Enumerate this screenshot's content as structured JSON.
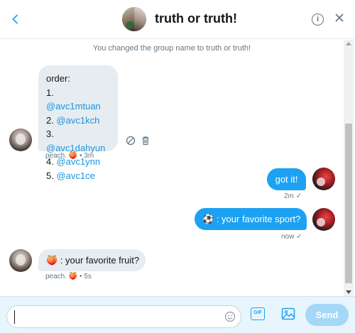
{
  "header": {
    "title": "truth or truth!",
    "back_icon": "chevron-left-icon",
    "info_icon": "info-icon",
    "close_icon": "close-icon"
  },
  "conversation": {
    "system_message": "You changed the group name to truth or truth!",
    "messages": [
      {
        "sender": "peach.",
        "direction": "incoming",
        "lines": [
          {
            "prefix": "order:",
            "mention": ""
          },
          {
            "prefix": "1. ",
            "mention": "@avc1mtuan"
          },
          {
            "prefix": "2. ",
            "mention": "@avc1kch"
          },
          {
            "prefix": "3. ",
            "mention": "@avc1dahyun"
          },
          {
            "prefix": "4. ",
            "mention": "@avc1ynn"
          },
          {
            "prefix": "5. ",
            "mention": "@avc1ce"
          }
        ],
        "meta": "peach. 🍑 • 3m"
      },
      {
        "direction": "outgoing",
        "text": "got it!",
        "meta": "2m",
        "status": "✓"
      },
      {
        "direction": "outgoing",
        "text": "⚽ : your favorite sport?",
        "meta": "now",
        "status": "✓"
      },
      {
        "sender": "peach.",
        "direction": "incoming",
        "text": "🍑 : your favorite fruit?",
        "meta": "peach. 🍑 • 5s"
      }
    ]
  },
  "composer": {
    "input_value": "",
    "gif_label": "GIF",
    "send_label": "Send",
    "emoji_icon": "smiley-icon",
    "media_icon": "image-icon"
  },
  "colors": {
    "accent": "#1da1f2",
    "incoming_bubble": "#e6ecf0",
    "send_disabled": "#a5d7f7"
  }
}
